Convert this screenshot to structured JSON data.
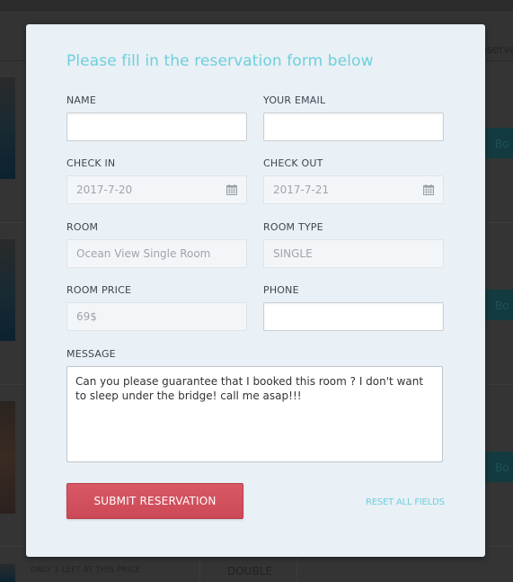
{
  "background": {
    "header_text": "Reserva",
    "book_buttons": [
      "Bo",
      "Bo",
      "Bo"
    ],
    "bottom_row": {
      "availability": "ONLY 3 LEFT AT THIS PRICE",
      "room_type": "DOUBLE"
    }
  },
  "modal": {
    "title": "Please fill in the reservation form below",
    "fields": {
      "name": {
        "label": "NAME",
        "value": ""
      },
      "email": {
        "label": "YOUR EMAIL",
        "value": ""
      },
      "check_in": {
        "label": "CHECK IN",
        "value": "2017-7-20",
        "icon": "calendar-icon"
      },
      "check_out": {
        "label": "CHECK OUT",
        "value": "2017-7-21",
        "icon": "calendar-icon"
      },
      "room": {
        "label": "ROOM",
        "value": "Ocean View Single Room"
      },
      "room_type": {
        "label": "ROOM TYPE",
        "value": "SINGLE"
      },
      "room_price": {
        "label": "ROOM PRICE",
        "value": "69$"
      },
      "phone": {
        "label": "PHONE",
        "value": ""
      },
      "message": {
        "label": "MESSAGE",
        "value": "Can you please guarantee that I booked this room ? I don't want to sleep under the bridge! call me asap!!!"
      }
    },
    "submit_label": "SUBMIT RESERVATION",
    "reset_label": "RESET ALL FIELDS"
  },
  "colors": {
    "accent": "#6dd0db",
    "submit": "#d45360",
    "modal_bg": "#e9f0f6",
    "overlay": "#343434"
  }
}
